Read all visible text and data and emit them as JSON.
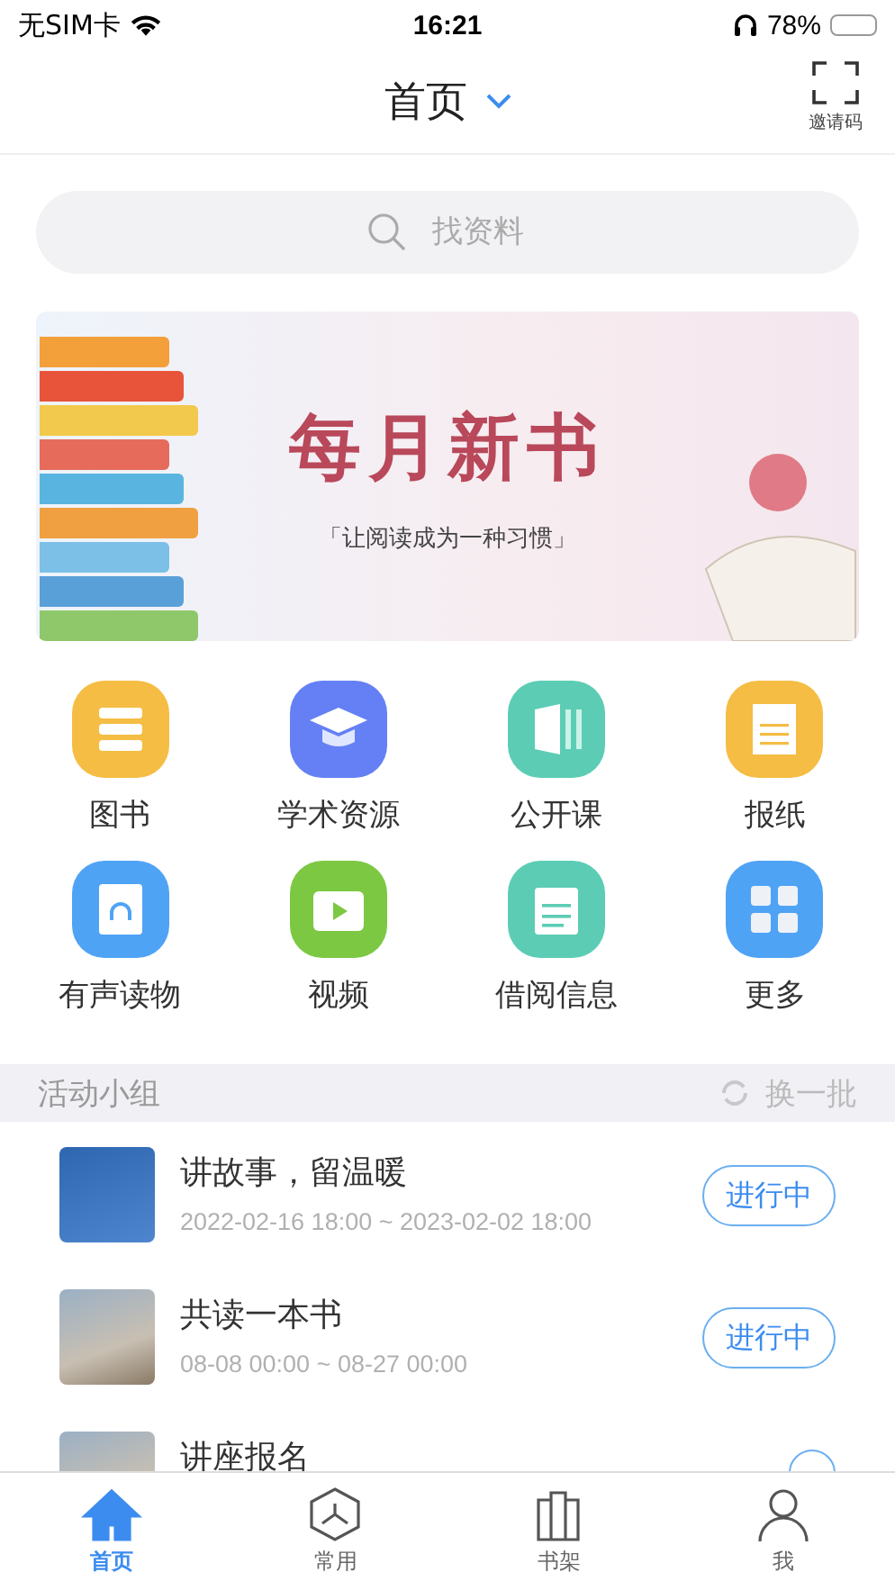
{
  "status_bar": {
    "carrier": "无SIM卡",
    "time": "16:21",
    "battery": "78%"
  },
  "nav": {
    "title": "首页",
    "scan_label": "邀请码"
  },
  "search": {
    "placeholder": "找资料"
  },
  "banner": {
    "title": "每月新书",
    "subtitle": "「让阅读成为一种习惯」"
  },
  "shortcuts": [
    {
      "label": "图书",
      "kind": "books",
      "color": "#f5bd44"
    },
    {
      "label": "学术资源",
      "kind": "academic",
      "color": "#6480f4"
    },
    {
      "label": "公开课",
      "kind": "course",
      "color": "#5ccdb4"
    },
    {
      "label": "报纸",
      "kind": "news",
      "color": "#f5bd44"
    },
    {
      "label": "有声读物",
      "kind": "audio",
      "color": "#4fa3f5"
    },
    {
      "label": "视频",
      "kind": "video",
      "color": "#7cc843"
    },
    {
      "label": "借阅信息",
      "kind": "borrow",
      "color": "#5ccdb4"
    },
    {
      "label": "更多",
      "kind": "more",
      "color": "#4fa3f5"
    }
  ],
  "section": {
    "title": "活动小组",
    "action": "换一批"
  },
  "activities": [
    {
      "title": "讲故事，留温暖",
      "time": "2022-02-16 18:00 ~ 2023-02-02 18:00",
      "status": "进行中"
    },
    {
      "title": "共读一本书",
      "time": "08-08 00:00 ~ 08-27 00:00",
      "status": "进行中"
    },
    {
      "title": "讲座报名"
    }
  ],
  "tabs": [
    {
      "label": "首页",
      "kind": "home",
      "selected": true
    },
    {
      "label": "常用",
      "kind": "common",
      "selected": false
    },
    {
      "label": "书架",
      "kind": "shelf",
      "selected": false
    },
    {
      "label": "我",
      "kind": "me",
      "selected": false
    }
  ]
}
